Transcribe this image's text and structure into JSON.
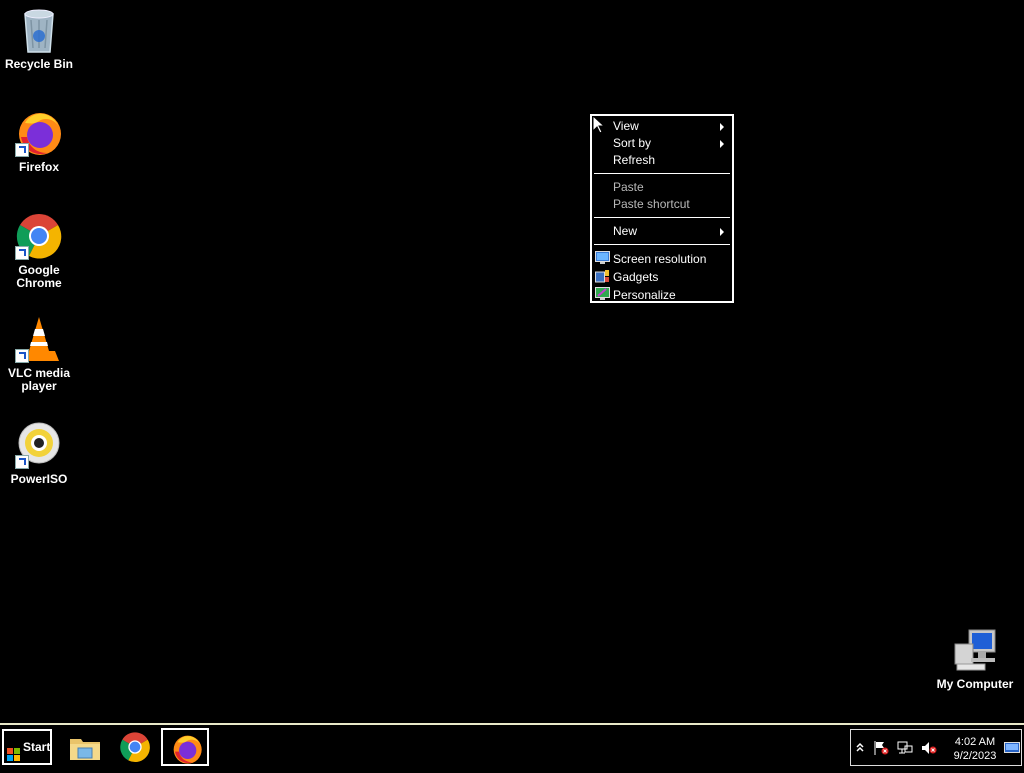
{
  "desktop": {
    "icons": [
      {
        "label": "Recycle Bin",
        "icon": "recycle-bin-icon"
      },
      {
        "label": "Firefox",
        "icon": "firefox-icon"
      },
      {
        "label": "Google Chrome",
        "icon": "chrome-icon"
      },
      {
        "label": "VLC media player",
        "icon": "vlc-icon"
      },
      {
        "label": "PowerISO",
        "icon": "poweriso-icon"
      },
      {
        "label": "My Computer",
        "icon": "my-computer-icon"
      }
    ]
  },
  "context_menu": {
    "items": [
      {
        "label": "View",
        "submenu": true,
        "disabled": false
      },
      {
        "label": "Sort by",
        "submenu": true,
        "disabled": false
      },
      {
        "label": "Refresh",
        "submenu": false,
        "disabled": false
      },
      {
        "label": "Paste",
        "submenu": false,
        "disabled": true
      },
      {
        "label": "Paste shortcut",
        "submenu": false,
        "disabled": true
      },
      {
        "label": "New",
        "submenu": true,
        "disabled": false
      },
      {
        "label": "Screen resolution",
        "icon": "screen-resolution-icon",
        "disabled": false
      },
      {
        "label": "Gadgets",
        "icon": "gadgets-icon",
        "disabled": false
      },
      {
        "label": "Personalize",
        "icon": "personalize-icon",
        "disabled": false
      }
    ]
  },
  "taskbar": {
    "start_label": "Start",
    "apps": [
      {
        "name": "File Explorer",
        "icon": "file-explorer-icon",
        "active": false
      },
      {
        "name": "Google Chrome",
        "icon": "chrome-icon",
        "active": false
      },
      {
        "name": "Firefox",
        "icon": "firefox-icon",
        "active": true
      }
    ],
    "tray": {
      "time": "4:02 AM",
      "date": "9/2/2023",
      "icons": [
        "show-hidden-icons",
        "action-center-flag-icon",
        "network-icon",
        "volume-muted-icon",
        "show-desktop-icon"
      ]
    }
  },
  "colors": {
    "background": "#000000",
    "text": "#ffffff",
    "disabled_text": "#b9b9b9",
    "taskbar_border": "#e8e8c8"
  }
}
